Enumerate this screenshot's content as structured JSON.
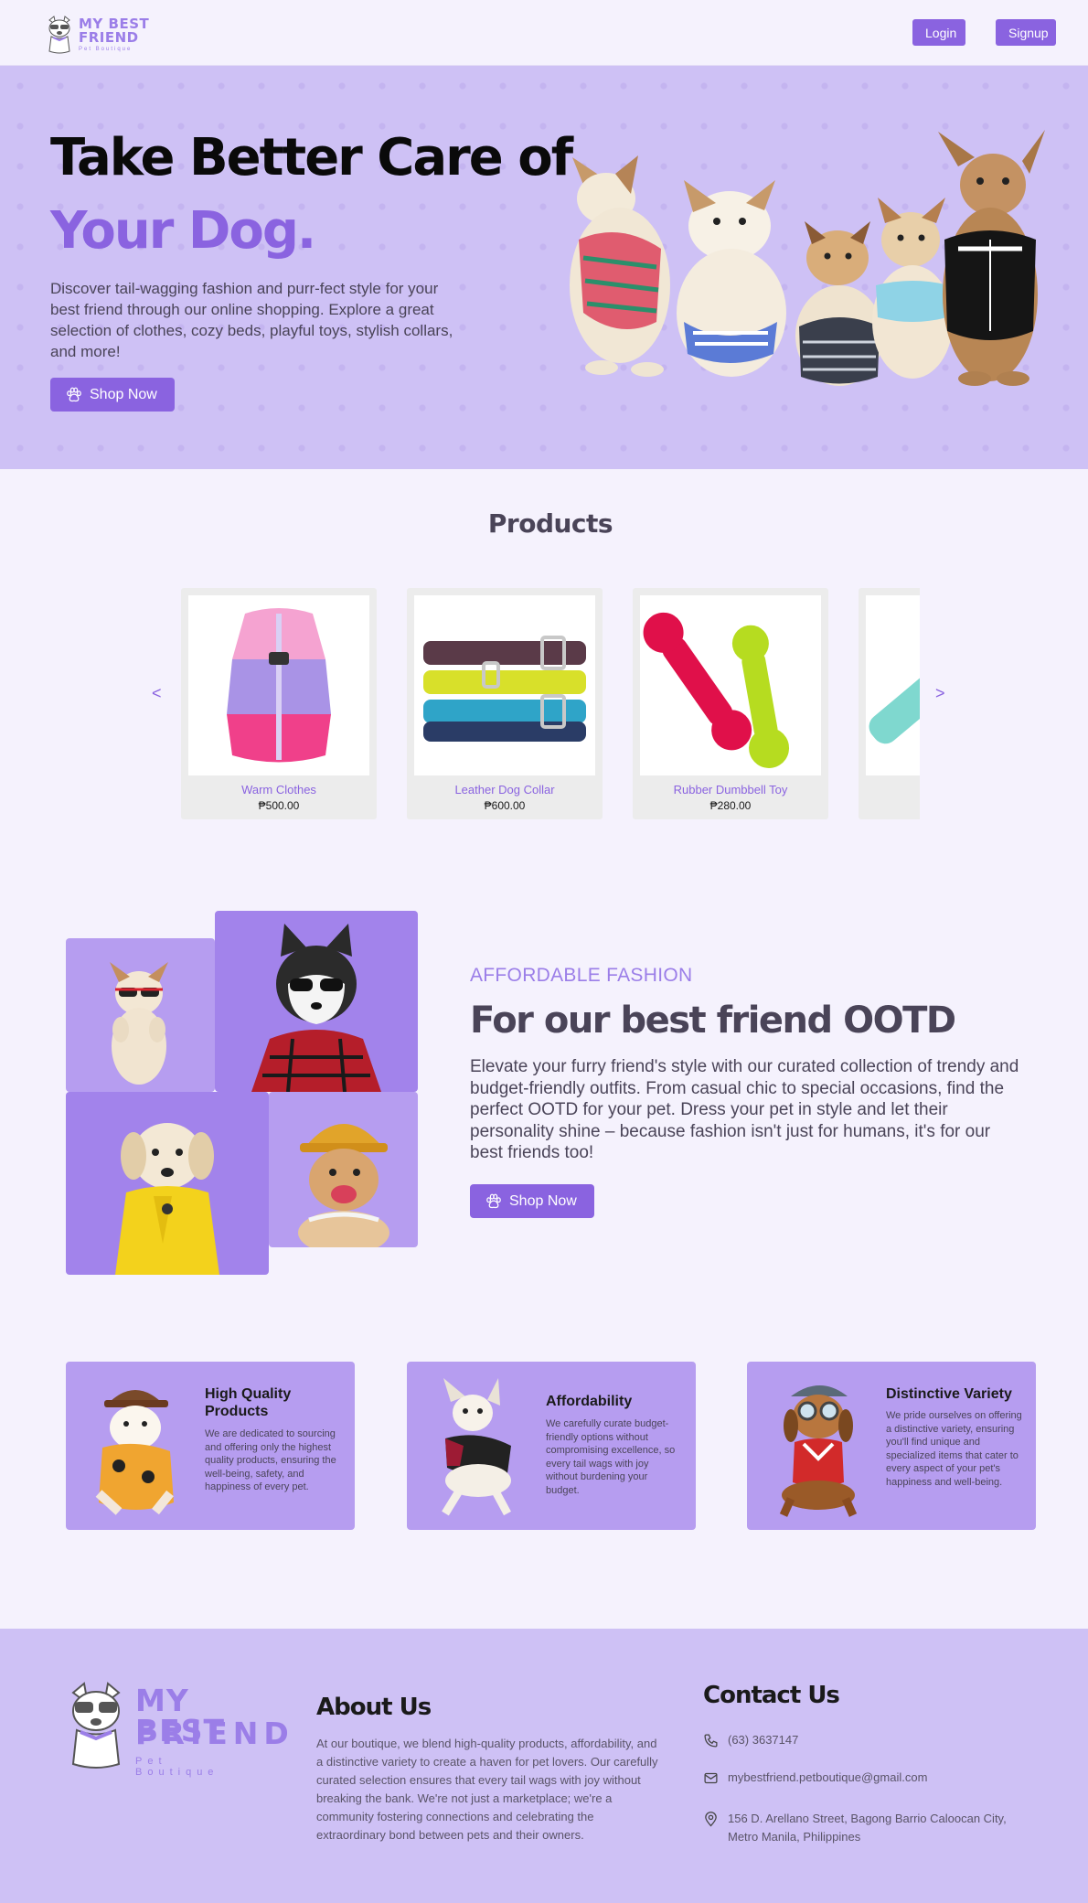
{
  "nav": {
    "brand_line1": "MY BEST",
    "brand_line2": "FRIEND",
    "brand_line3": "Pet Boutique",
    "login_label": "Login",
    "signup_label": "Signup"
  },
  "hero": {
    "title_line1": "Take Better Care of",
    "title_line2": "Your Dog.",
    "description": "Discover tail-wagging fashion and purr-fect style for your best friend through our online shopping. Explore a great selection of clothes, cozy beds, playful toys, stylish collars, and more!",
    "shop_label": "Shop Now"
  },
  "products": {
    "title": "Products",
    "prev_label": "<",
    "next_label": ">",
    "items": [
      {
        "name": "Warm Clothes",
        "price": "₱500.00"
      },
      {
        "name": "Leather Dog Collar",
        "price": "₱600.00"
      },
      {
        "name": "Rubber Dumbbell Toy",
        "price": "₱280.00"
      }
    ]
  },
  "fashion": {
    "eyebrow": "AFFORDABLE FASHION",
    "title": "For our best friend OOTD",
    "description": "Elevate your furry friend's style with our curated collection of trendy and budget-friendly outfits. From casual chic to special occasions, find the perfect OOTD for your pet. Dress your pet in style and let their personality shine – because fashion isn't just for humans, it's for our best friends too!",
    "shop_label": "Shop Now"
  },
  "features": [
    {
      "title": "High Quality Products",
      "description": "We are dedicated to sourcing and offering only the highest quality products, ensuring the well-being, safety, and happiness of every pet."
    },
    {
      "title": "Affordability",
      "description": "We carefully curate budget-friendly options without compromising excellence, so every tail wags with joy without burdening your budget."
    },
    {
      "title": "Distinctive Variety",
      "description": "We pride ourselves on offering a distinctive variety, ensuring you'll find unique and specialized items that cater to every aspect of your pet's happiness and well-being."
    }
  ],
  "footer": {
    "brand_line1": "MY BEST",
    "brand_line2": "FRIEND",
    "brand_line3": "Pet Boutique",
    "about_title": "About Us",
    "about_text": "At our boutique, we blend high-quality products, affordability, and a distinctive variety to create a haven for pet lovers. Our carefully curated selection ensures that every tail wags with joy without breaking the bank. We're not just a marketplace; we're a community fostering connections and celebrating the extraordinary bond between pets and their owners.",
    "contact_title": "Contact Us",
    "phone": "(63) 3637147",
    "email": "mybestfriend.petboutique@gmail.com",
    "address": "156 D. Arellano Street, Bagong Barrio Caloocan City, Metro Manila, Philippines"
  },
  "colors": {
    "accent": "#8a63e0",
    "hero_bg": "#cec1f5",
    "tile_dark": "#a283eb",
    "tile_light": "#b69df0",
    "page_bg": "#f5f2fd"
  },
  "icons": {
    "paw": "paw-icon",
    "phone": "phone-icon",
    "email": "email-icon",
    "location": "location-icon"
  }
}
